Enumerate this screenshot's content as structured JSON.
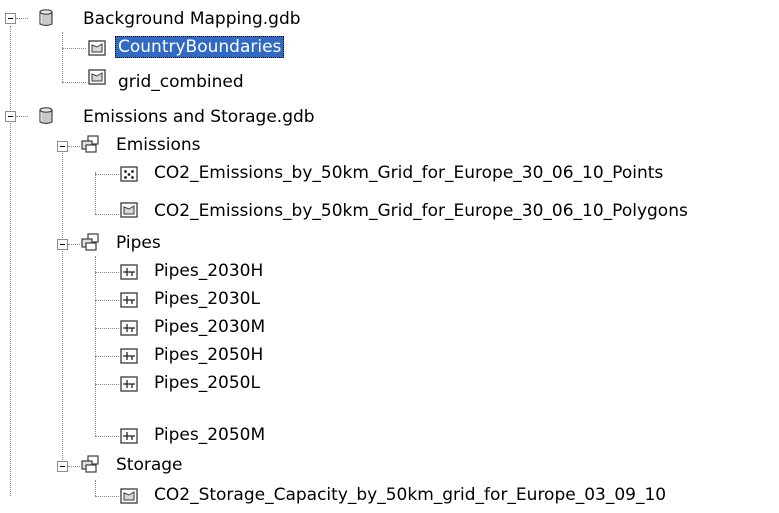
{
  "tree": {
    "items": [
      {
        "label": "Background Mapping.gdb",
        "icon": "geodatabase-icon",
        "expanded": true
      },
      {
        "label": "CountryBoundaries",
        "icon": "polygon-feature-class-icon",
        "selected": true
      },
      {
        "label": "grid_combined",
        "icon": "polygon-feature-class-icon"
      },
      {
        "label": "Emissions and Storage.gdb",
        "icon": "geodatabase-icon",
        "expanded": true
      },
      {
        "label": "Emissions",
        "icon": "feature-dataset-icon",
        "expanded": true
      },
      {
        "label": "CO2_Emissions_by_50km_Grid_for_Europe_30_06_10_Points",
        "icon": "point-feature-class-icon"
      },
      {
        "label": "CO2_Emissions_by_50km_Grid_for_Europe_30_06_10_Polygons",
        "icon": "polygon-feature-class-icon"
      },
      {
        "label": "Pipes",
        "icon": "feature-dataset-icon",
        "expanded": true
      },
      {
        "label": "Pipes_2030H",
        "icon": "line-feature-class-icon"
      },
      {
        "label": "Pipes_2030L",
        "icon": "line-feature-class-icon"
      },
      {
        "label": "Pipes_2030M",
        "icon": "line-feature-class-icon"
      },
      {
        "label": "Pipes_2050H",
        "icon": "line-feature-class-icon"
      },
      {
        "label": "Pipes_2050L",
        "icon": "line-feature-class-icon"
      },
      {
        "label": "Pipes_2050M",
        "icon": "line-feature-class-icon"
      },
      {
        "label": "Storage",
        "icon": "feature-dataset-icon",
        "expanded": true
      },
      {
        "label": "CO2_Storage_Capacity_by_50km_grid_for_Europe_03_09_10",
        "icon": "polygon-feature-class-icon"
      }
    ]
  },
  "colors": {
    "selection_background": "#316ac5",
    "selection_text": "#ffffff",
    "tree_lines": "#8a8a8a"
  }
}
